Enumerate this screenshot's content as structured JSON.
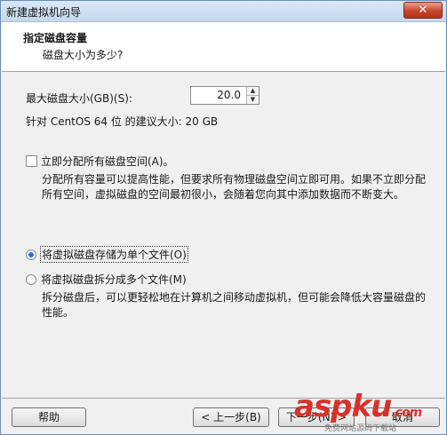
{
  "window": {
    "title": "新建虚拟机向导",
    "close_label": "✕"
  },
  "header": {
    "title": "指定磁盘容量",
    "subtitle": "磁盘大小为多少?"
  },
  "disk": {
    "max_size_label": "最大磁盘大小(GB)(S):",
    "max_size_value": "20.0",
    "recommendation": "针对 CentOS 64 位 的建议大小: 20 GB"
  },
  "allocate": {
    "label": "立即分配所有磁盘空间(A)。",
    "description": "分配所有容量可以提高性能，但要求所有物理磁盘空间立即可用。如果不立即分配所有空间，虚拟磁盘的空间最初很小，会随着您向其中添加数据而不断变大。"
  },
  "storage": {
    "single_label": "将虚拟磁盘存储为单个文件(O)",
    "multi_label": "将虚拟磁盘拆分成多个文件(M)",
    "multi_description": "拆分磁盘后，可以更轻松地在计算机之间移动虚拟机，但可能会降低大容量磁盘的性能。"
  },
  "footer": {
    "help_label": "帮助",
    "back_label": "< 上一步(B)",
    "next_label": "下一步(N) >",
    "cancel_label": "取消"
  },
  "watermark": {
    "text": "aspku",
    "suffix": ".com",
    "sub": "免费网站源码下载站"
  }
}
